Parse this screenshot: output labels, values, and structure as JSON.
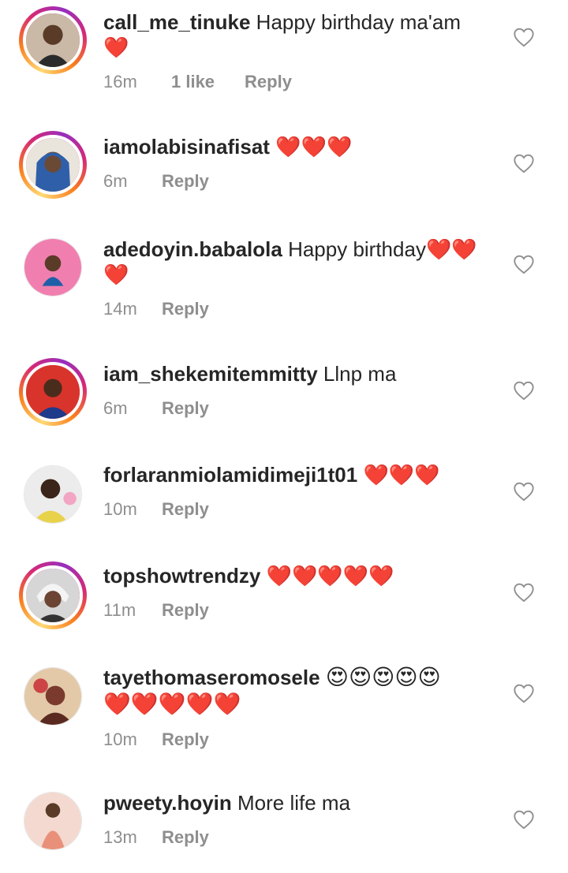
{
  "comments": [
    {
      "username": "call_me_tinuke",
      "message": "Happy birthday ma'am",
      "line2": "❤️",
      "time": "16m",
      "likes": "1 like",
      "reply": "Reply",
      "avatar_color": "#8a6b55",
      "story": true
    },
    {
      "username": "iamolabisinafisat",
      "message": "❤️❤️❤️",
      "line2": "",
      "time": "6m",
      "likes": "",
      "reply": "Reply",
      "avatar_color": "#2f5fa8",
      "story": true
    },
    {
      "username": "adedoyin.babalola",
      "message": "Happy birthday❤️❤️",
      "line2": "❤️",
      "time": "14m",
      "likes": "",
      "reply": "Reply",
      "avatar_color": "#f07fb0",
      "story": false
    },
    {
      "username": "iam_shekemitemmitty",
      "message": "Llnp ma",
      "line2": "",
      "time": "6m",
      "likes": "",
      "reply": "Reply",
      "avatar_color": "#c0392b",
      "story": true
    },
    {
      "username": "forlaranmiolamidimeji1t01",
      "message": "❤️❤️❤️",
      "line2": "",
      "time": "10m",
      "likes": "",
      "reply": "Reply",
      "avatar_color": "#e8d24a",
      "story": false
    },
    {
      "username": "topshowtrendzy",
      "message": "❤️❤️❤️❤️❤️",
      "line2": "",
      "time": "11m",
      "likes": "",
      "reply": "Reply",
      "avatar_color": "#d9d9d9",
      "story": true
    },
    {
      "username": "tayethomaseromosele",
      "message": "😍😍😍😍😍",
      "line2": "❤️❤️❤️❤️❤️",
      "time": "10m",
      "likes": "",
      "reply": "Reply",
      "avatar_color": "#7a3b2e",
      "story": false
    },
    {
      "username": "pweety.hoyin",
      "message": "More life ma",
      "line2": "",
      "time": "13m",
      "likes": "",
      "reply": "Reply",
      "avatar_color": "#e9a08a",
      "story": false
    }
  ],
  "icons": {
    "like": "heart-outline-icon"
  }
}
